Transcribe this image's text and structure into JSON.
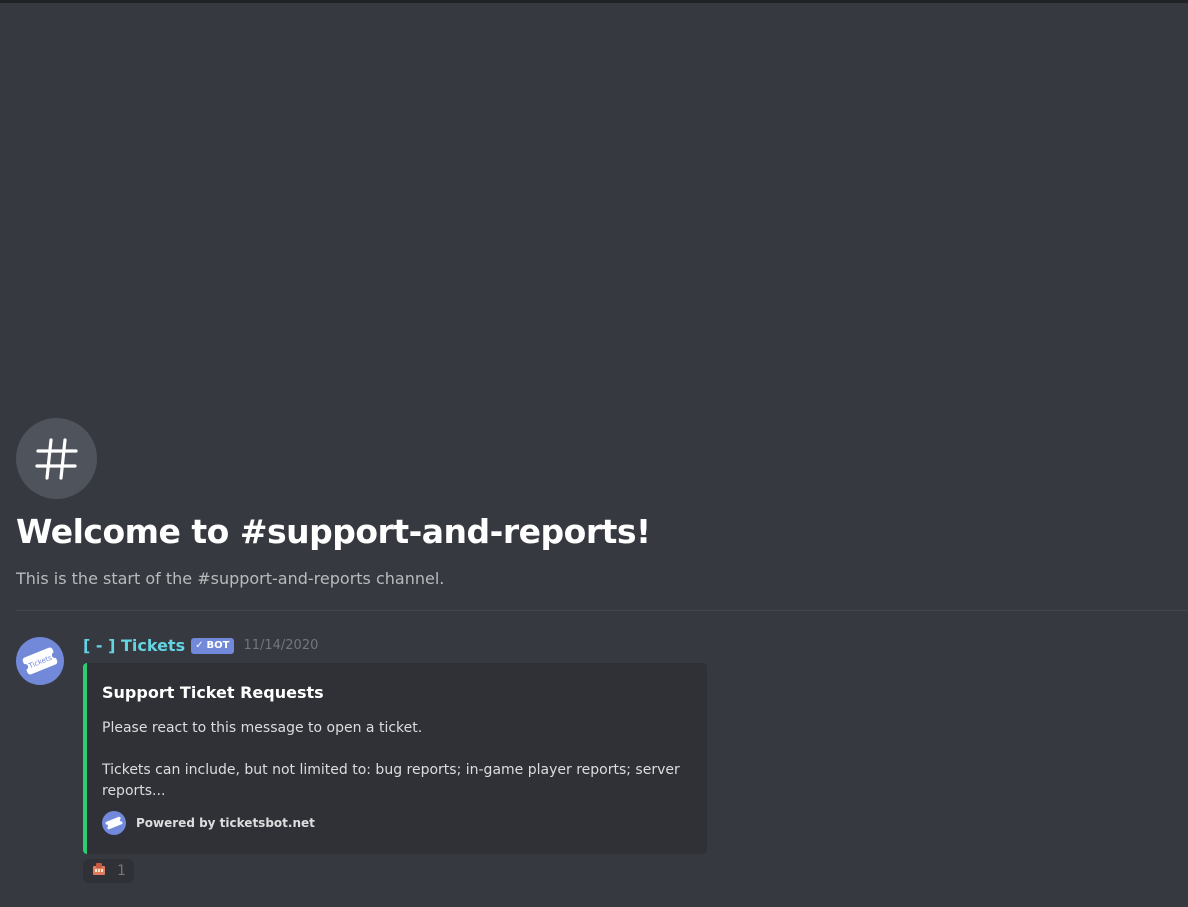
{
  "channel": {
    "welcome_title": "Welcome to #support-and-reports!",
    "welcome_subtitle": "This is the start of the #support-and-reports channel."
  },
  "message": {
    "username": "[ - ] Tickets",
    "bot_tag": "BOT",
    "timestamp": "11/14/2020",
    "avatar_label": "Tickets",
    "embed": {
      "accent_color": "#2ecc71",
      "title": "Support Ticket Requests",
      "description_line1": "Please react to this message to open a ticket.",
      "description_line2": "Tickets can include, but not limited to: bug reports; in-game player reports; server reports...",
      "footer": "Powered by ticketsbot.net"
    },
    "reaction": {
      "emoji": "ticket-emoji",
      "count": "1"
    }
  },
  "colors": {
    "background": "#36393f",
    "embed_background": "#2f3136",
    "username": "#63d4e2",
    "bot_tag": "#7289da"
  }
}
